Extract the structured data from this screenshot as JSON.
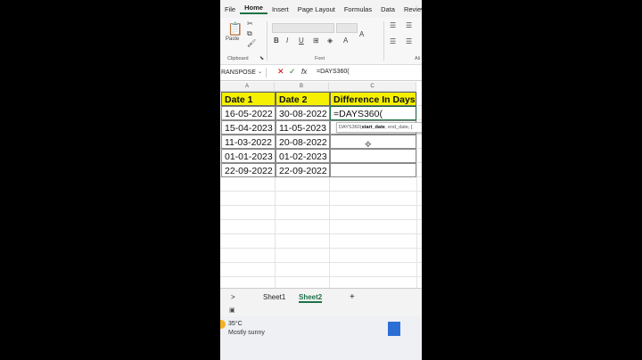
{
  "ribbon": {
    "tabs": [
      "File",
      "Home",
      "Insert",
      "Page Layout",
      "Formulas",
      "Data",
      "Review"
    ],
    "active_tab": "Home",
    "groups": {
      "clipboard": "Clipboard",
      "font": "Font",
      "alignment": "Ali"
    },
    "paste_label": "Paste",
    "bold": "B",
    "italic": "I",
    "underline": "U"
  },
  "formula_bar": {
    "name_box": "RANSPOSE",
    "cancel_icon": "✕",
    "confirm_icon": "✓",
    "fx_label": "fx",
    "content": "=DAYS360("
  },
  "columns": [
    "A",
    "B",
    "C"
  ],
  "table": {
    "headers": [
      "Date 1",
      "Date 2",
      "Difference In Days"
    ],
    "rows": [
      [
        "16-05-2022",
        "30-08-2022",
        "=DAYS360("
      ],
      [
        "15-04-2023",
        "11-05-2023",
        ""
      ],
      [
        "11-03-2022",
        "20-08-2022",
        ""
      ],
      [
        "01-01-2023",
        "01-02-2023",
        ""
      ],
      [
        "22-09-2022",
        "22-09-2022",
        ""
      ]
    ]
  },
  "tooltip": {
    "fn": "DAYS360(",
    "arg1": "start_date",
    "rest": ", end_date, ["
  },
  "sheets": {
    "nav": ">",
    "items": [
      "Sheet1",
      "Sheet2"
    ],
    "active": "Sheet2",
    "add": "+"
  },
  "taskbar": {
    "temperature": "35°C",
    "weather": "Mostly sunny"
  },
  "colors": {
    "accent": "#1e7145",
    "header_fill": "#f5f000"
  }
}
